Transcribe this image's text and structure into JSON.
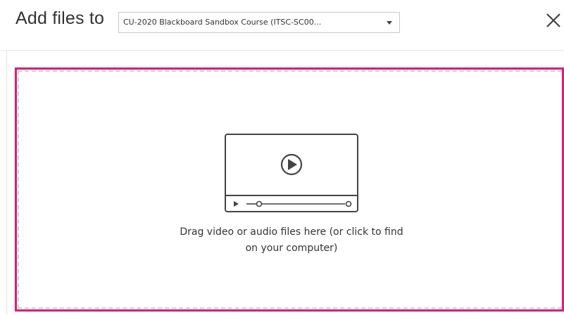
{
  "header": {
    "title": "Add files to",
    "course_select": {
      "selected": "CU-2020 Blackboard Sandbox Course (ITSC-SC00..."
    },
    "close_icon": "close-icon"
  },
  "dropzone": {
    "message_line1": "Drag video or audio files here (or click to find",
    "message_line2": "on your computer)",
    "icon": "video-player-icon"
  },
  "colors": {
    "dropzone_border": "#e4197a",
    "dash": "#cfcfcf",
    "text": "#333333"
  }
}
